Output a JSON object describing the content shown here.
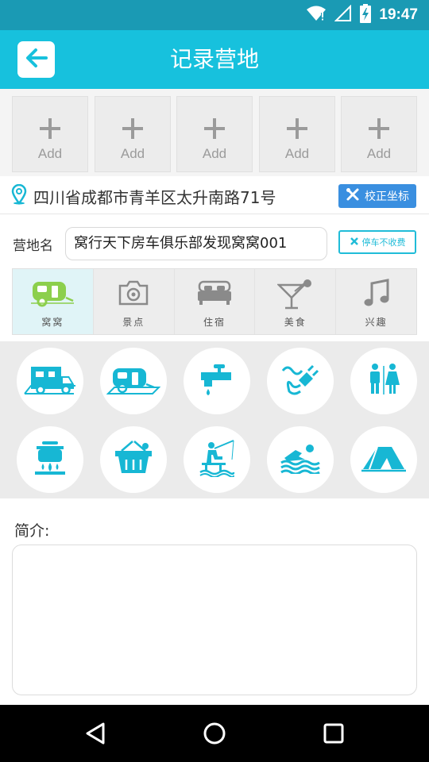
{
  "status_bar": {
    "time": "19:47",
    "icons": [
      "wifi-icon",
      "signal-icon",
      "battery-charging-icon"
    ]
  },
  "app_bar": {
    "title": "记录营地",
    "back_icon": "arrow-left-icon"
  },
  "photos": {
    "slots": [
      {
        "label": "Add"
      },
      {
        "label": "Add"
      },
      {
        "label": "Add"
      },
      {
        "label": "Add"
      },
      {
        "label": "Add"
      }
    ]
  },
  "location": {
    "address": "四川省成都市青羊区太升南路71号",
    "correct_button": "校正坐标",
    "pin_icon": "location-pin-icon"
  },
  "camp_name": {
    "label": "营地名",
    "value": "窝行天下房车俱乐部发现窝窝001",
    "fee_button": "停车不收费"
  },
  "category_tabs": [
    {
      "label": "窝窝",
      "icon": "caravan-icon",
      "active": true
    },
    {
      "label": "景点",
      "icon": "camera-icon",
      "active": false
    },
    {
      "label": "住宿",
      "icon": "bed-icon",
      "active": false
    },
    {
      "label": "美食",
      "icon": "cocktail-icon",
      "active": false
    },
    {
      "label": "兴趣",
      "icon": "music-note-icon",
      "active": false
    }
  ],
  "amenities": [
    {
      "icon": "motorhome-icon"
    },
    {
      "icon": "trailer-icon"
    },
    {
      "icon": "water-tap-icon"
    },
    {
      "icon": "power-plug-icon"
    },
    {
      "icon": "restroom-icon"
    },
    {
      "icon": "cooking-pot-icon"
    },
    {
      "icon": "shopping-basket-icon"
    },
    {
      "icon": "fishing-icon"
    },
    {
      "icon": "swimming-icon"
    },
    {
      "icon": "tent-icon"
    }
  ],
  "intro": {
    "label": "简介:",
    "value": ""
  },
  "colors": {
    "accent": "#17c1dd",
    "status_bar": "#1a9ab4",
    "button_blue": "#3a8fe0",
    "active_tab": "#e0f4f7",
    "icon_green": "#8ccf4d"
  }
}
